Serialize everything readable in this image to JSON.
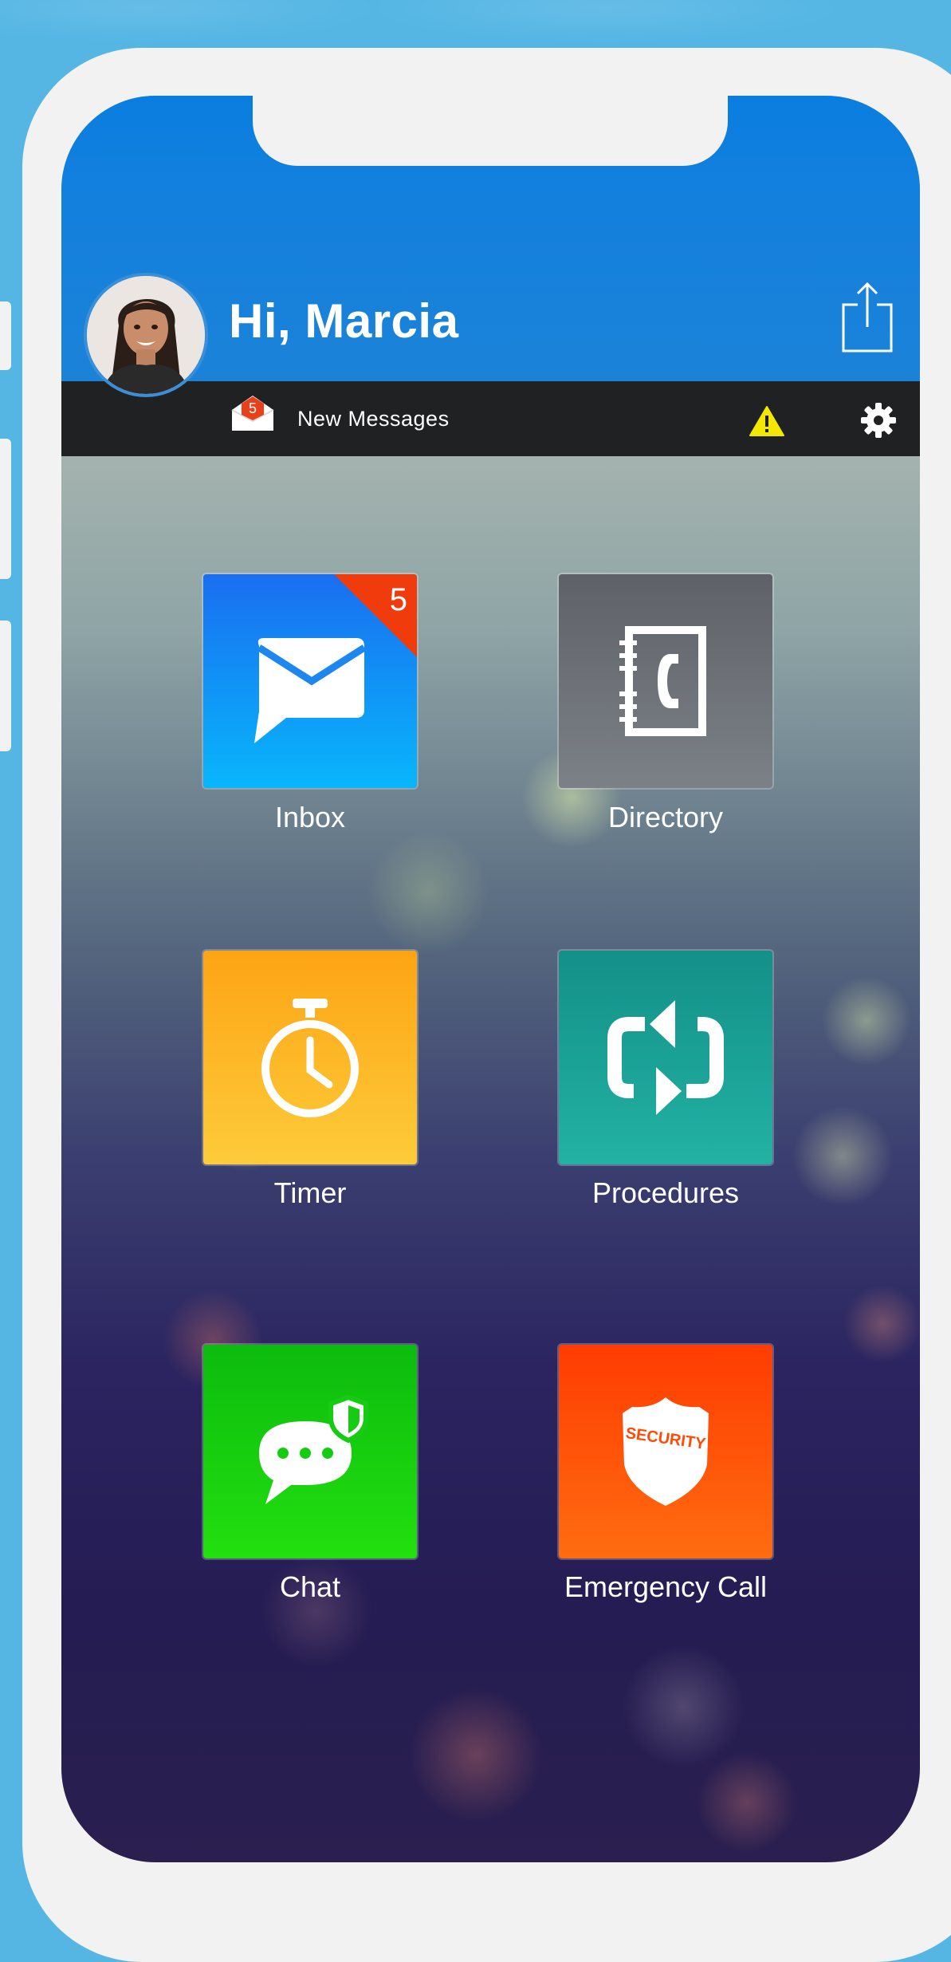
{
  "header": {
    "greeting": "Hi, Marcia"
  },
  "status_bar": {
    "new_messages_count": "5",
    "new_messages_label": "New Messages"
  },
  "tiles": {
    "inbox": {
      "label": "Inbox",
      "badge": "5"
    },
    "directory": {
      "label": "Directory"
    },
    "timer": {
      "label": "Timer"
    },
    "procedures": {
      "label": "Procedures"
    },
    "chat": {
      "label": "Chat"
    },
    "emergency": {
      "label": "Emergency Call",
      "shield_text": "SECURITY"
    }
  },
  "icons": {
    "share": "share-icon",
    "warning": "warning-icon",
    "settings": "gear-icon",
    "inbox": "chat-envelope-icon",
    "directory": "phonebook-icon",
    "timer": "stopwatch-icon",
    "procedures": "refresh-icon",
    "chat": "secure-chat-icon",
    "emergency": "security-shield-icon"
  },
  "colors": {
    "header_blue": "#1480dd",
    "status_bar": "#1f2123",
    "warning_yellow": "#f5e800",
    "badge_red": "#f03c0c",
    "inbox_tile": "#1b8ef0",
    "directory_tile": "#6f747a",
    "timer_tile": "#fdb92a",
    "procedures_tile": "#19a096",
    "chat_tile": "#18cc10",
    "emergency_tile": "#ff5208"
  }
}
